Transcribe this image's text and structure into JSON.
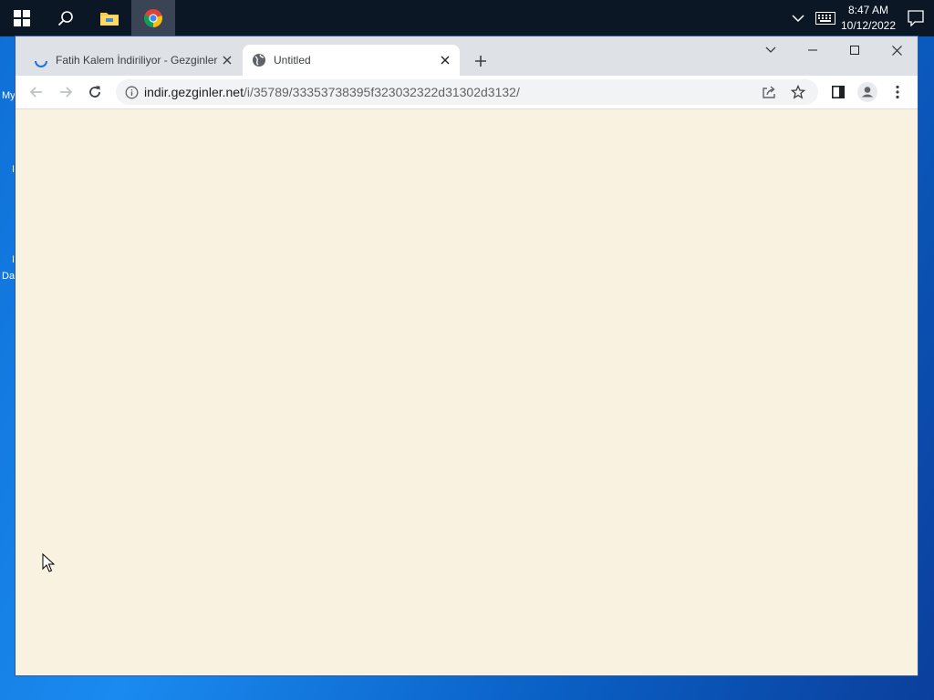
{
  "taskbar": {
    "start_icon": "windows-start-icon",
    "search_icon": "search-icon",
    "apps": [
      {
        "name": "file-explorer-icon",
        "active": false
      },
      {
        "name": "chrome-icon",
        "active": true
      }
    ],
    "tray": {
      "chevron_icon": "chevron-up-icon",
      "keyboard_icon": "keyboard-icon",
      "time": "8:47 AM",
      "date": "10/12/2022",
      "notification_icon": "notification-icon"
    }
  },
  "desktop": {
    "labels": [
      "My",
      "I",
      "I",
      "Da"
    ]
  },
  "browser": {
    "tabs": [
      {
        "title": "Fatih Kalem İndiriliyor - Gezginler",
        "favicon": "loading-spinner-icon",
        "active": false
      },
      {
        "title": "Untitled",
        "favicon": "globe-icon",
        "active": true
      }
    ],
    "new_tab_label": "+",
    "window_controls": [
      "tab-search-icon",
      "minimize-icon",
      "maximize-icon",
      "close-icon"
    ],
    "toolbar": {
      "back_icon": "back-arrow-icon",
      "forward_icon": "forward-arrow-icon",
      "reload_icon": "reload-icon",
      "url_host": "indir.gezginler.net",
      "url_path": "/i/35789/33353738395f323032322d31302d3132/",
      "info_icon": "info-icon",
      "share_icon": "share-icon",
      "bookmark_icon": "star-icon",
      "side_panel_icon": "side-panel-icon",
      "profile_icon": "profile-icon",
      "menu_icon": "kebab-menu-icon"
    },
    "content_bg": "#faf2e1"
  },
  "colors": {
    "taskbar": "#0c1726",
    "tabstrip": "#dee1e6",
    "active_tab": "#ffffff",
    "omnibox": "#f1f3f4",
    "spinner": "#1a73e8"
  }
}
